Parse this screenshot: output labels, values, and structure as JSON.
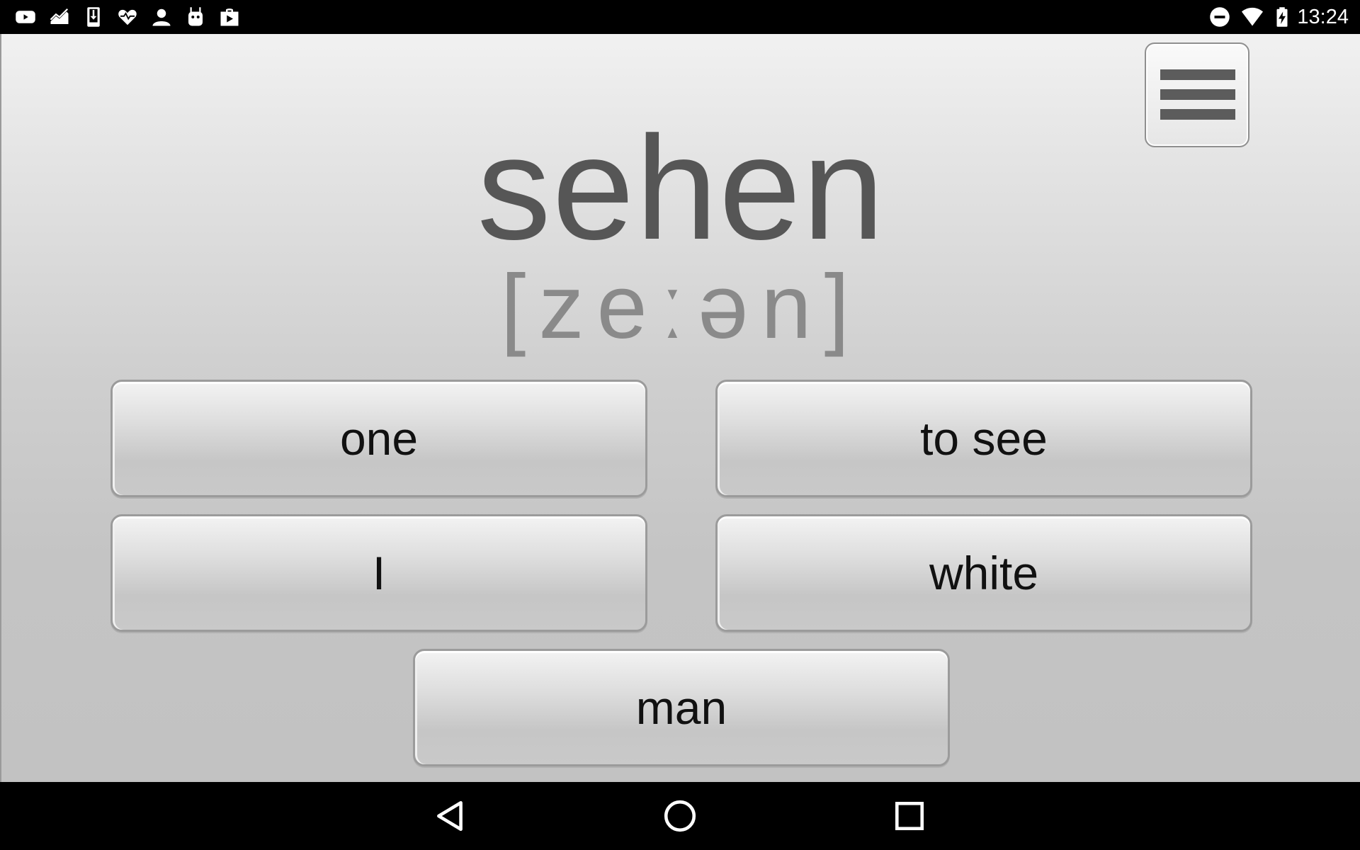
{
  "status_bar": {
    "time": "13:24",
    "left_icons": [
      "youtube-icon",
      "chart-icon",
      "download-icon",
      "heart-icon",
      "account-icon",
      "android-icon",
      "store-icon"
    ],
    "right_icons": [
      "do-not-disturb-icon",
      "wifi-icon",
      "battery-charging-icon"
    ]
  },
  "quiz": {
    "word": "sehen",
    "pronunciation": "[zeːən]",
    "answers": [
      {
        "label": "one"
      },
      {
        "label": "to see"
      },
      {
        "label": "I"
      },
      {
        "label": "white"
      },
      {
        "label": "man"
      }
    ]
  },
  "navigation": {
    "buttons": [
      "back",
      "home",
      "recents"
    ]
  }
}
